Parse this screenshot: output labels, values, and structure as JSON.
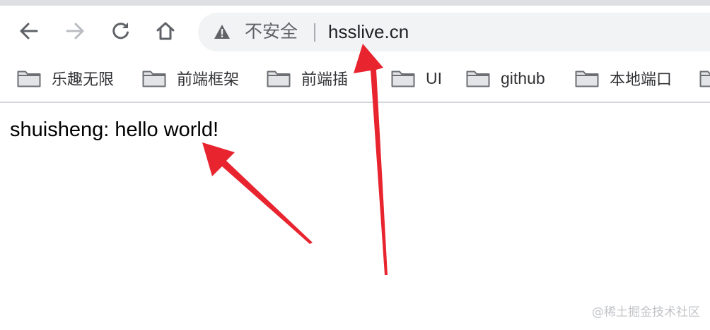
{
  "toolbar": {
    "back": "arrow-left-icon",
    "forward": "arrow-right-icon",
    "reload": "reload-icon",
    "home": "home-icon"
  },
  "omnibox": {
    "security_icon": "warning-triangle-icon",
    "security_label": "不安全",
    "url": "hsslive.cn"
  },
  "bookmarks": [
    {
      "label": "乐趣无限",
      "icon": "folder-icon"
    },
    {
      "label": "前端框架",
      "icon": "folder-icon"
    },
    {
      "label": "前端插",
      "icon": "folder-icon"
    },
    {
      "label": "UI",
      "icon": "folder-icon"
    },
    {
      "label": "github",
      "icon": "folder-icon"
    },
    {
      "label": "本地端口",
      "icon": "folder-icon"
    }
  ],
  "page": {
    "text": "shuisheng: hello world!"
  },
  "annotations": {
    "arrow_color": "#e8242f"
  },
  "watermark": "@稀土掘金技术社区"
}
